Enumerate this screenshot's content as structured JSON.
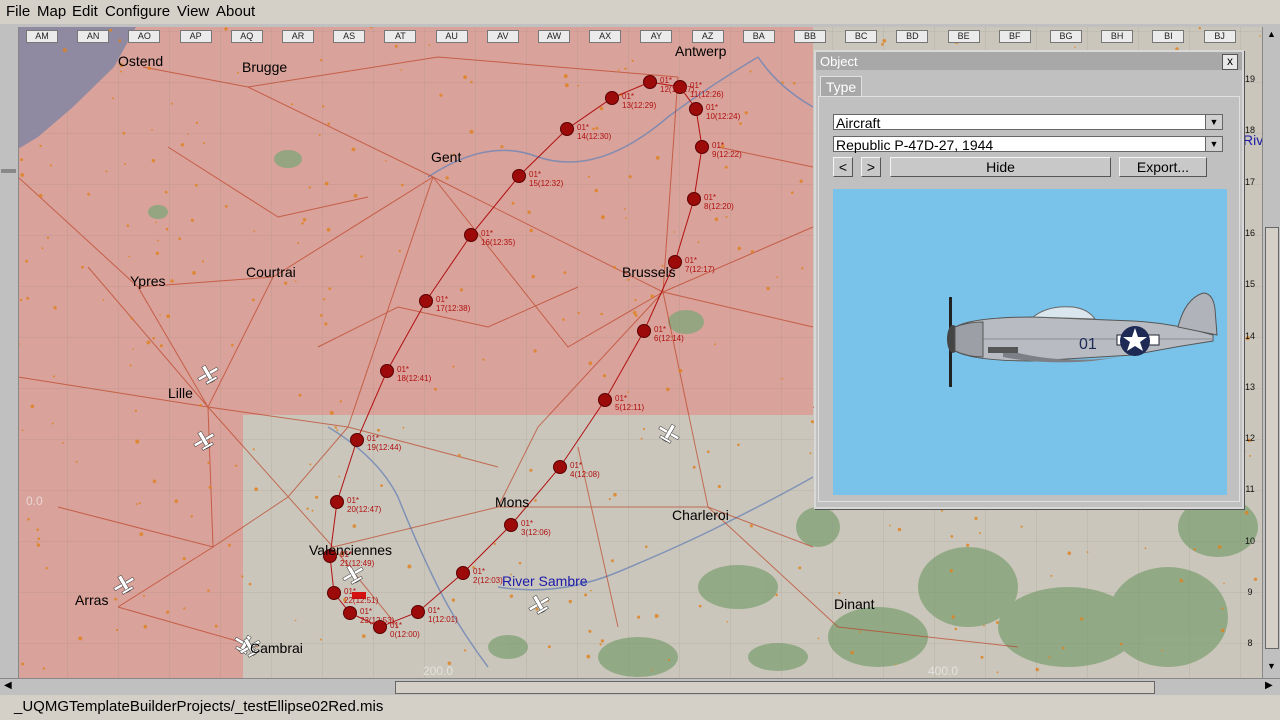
{
  "menu": [
    "File",
    "Map",
    "Edit",
    "Configure",
    "View",
    "About"
  ],
  "grid_columns": [
    "AM",
    "AN",
    "AO",
    "AP",
    "AQ",
    "AR",
    "AS",
    "AT",
    "AU",
    "AV",
    "AW",
    "AX",
    "AY",
    "AZ",
    "BA",
    "BB",
    "BC",
    "BD",
    "BE",
    "BF",
    "BG",
    "BH",
    "BI",
    "BJ"
  ],
  "grid_rows": [
    "19",
    "18",
    "17",
    "16",
    "15",
    "14",
    "13",
    "12",
    "11",
    "10",
    "9",
    "8"
  ],
  "cities": {
    "ostend": "Ostend",
    "brugge": "Brugge",
    "antwerp": "Antwerp",
    "gent": "Gent",
    "ypres": "Ypres",
    "courtrai": "Courtrai",
    "brussels": "Brussels",
    "lille": "Lille",
    "mons": "Mons",
    "charleroi": "Charleroi",
    "valenciennes": "Valenciennes",
    "arras": "Arras",
    "cambrai": "Cambrai",
    "dinant": "Dinant"
  },
  "rivers": {
    "sambre": "River Sambre",
    "edge": "Rive"
  },
  "waypoints": [
    {
      "label": "01*",
      "sub": "0(12:00)"
    },
    {
      "label": "01*",
      "sub": "1(12:01)"
    },
    {
      "label": "01*",
      "sub": "2(12:03)"
    },
    {
      "label": "01*",
      "sub": "3(12:06)"
    },
    {
      "label": "01*",
      "sub": "4(12:08)"
    },
    {
      "label": "01*",
      "sub": "5(12:11)"
    },
    {
      "label": "01*",
      "sub": "6(12:14)"
    },
    {
      "label": "01*",
      "sub": "7(12:17)"
    },
    {
      "label": "01*",
      "sub": "8(12:20)"
    },
    {
      "label": "01*",
      "sub": "9(12:22)"
    },
    {
      "label": "01*",
      "sub": "10(12:24)"
    },
    {
      "label": "01*",
      "sub": "11(12:26)"
    },
    {
      "label": "01*",
      "sub": "12(12:27)"
    },
    {
      "label": "01*",
      "sub": "13(12:29)"
    },
    {
      "label": "01*",
      "sub": "14(12:30)"
    },
    {
      "label": "01*",
      "sub": "15(12:32)"
    },
    {
      "label": "01*",
      "sub": "16(12:35)"
    },
    {
      "label": "01*",
      "sub": "17(12:38)"
    },
    {
      "label": "01*",
      "sub": "18(12:41)"
    },
    {
      "label": "01*",
      "sub": "19(12:44)"
    },
    {
      "label": "01*",
      "sub": "20(12:47)"
    },
    {
      "label": "01*",
      "sub": "21(12:49)"
    },
    {
      "label": "01*",
      "sub": "22(12:51)"
    },
    {
      "label": "01*",
      "sub": "23(12:53)"
    }
  ],
  "object_panel": {
    "title": "Object",
    "close": "x",
    "tab": "Type",
    "category": "Aircraft",
    "model": "Republic P-47D-27, 1944",
    "prev": "<",
    "next": ">",
    "hide": "Hide",
    "export": "Export...",
    "aircraft_code": "01"
  },
  "status": "_UQMGTemplateBuilderProjects/_testEllipse02Red.mis",
  "colors": {
    "enemy_zone": "#d9a29a",
    "neutral_zone": "#cbc6bb",
    "sea": "#8f8aa2",
    "waypoint": "#9c0a0a",
    "route": "#b01010",
    "road": "#bb3a1c",
    "panel_sky": "#79c3ea"
  },
  "icons": {
    "waypoint": "circle-marker",
    "airfield": "aircraft-icon",
    "close": "close-icon"
  }
}
